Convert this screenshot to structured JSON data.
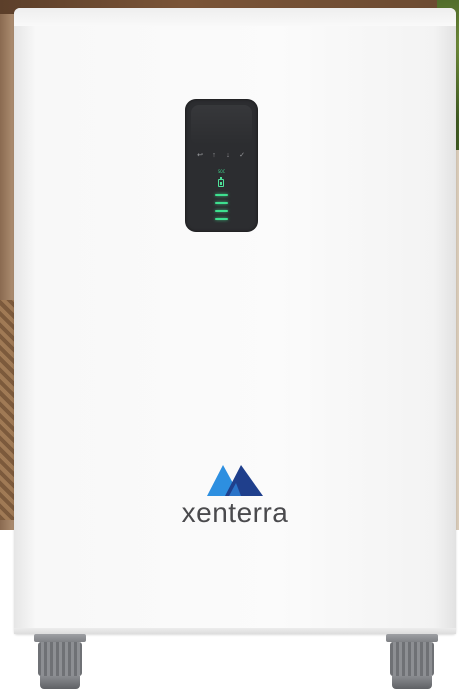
{
  "brand": {
    "name": "xenterra",
    "colors": {
      "wordmark": "#4a4a4d",
      "mark_left": "#2d8fe0",
      "mark_right": "#1f3f8c",
      "indicator_green": "#3ee08f",
      "panel": "#2c2d30",
      "cabinet": "#f7f7f7"
    },
    "logo_icon": "mountain-peaks-icon"
  },
  "panel": {
    "soc_label": "SOC",
    "buttons": [
      {
        "icon": "back-icon",
        "glyph": "↩"
      },
      {
        "icon": "up-icon",
        "glyph": "↑"
      },
      {
        "icon": "down-icon",
        "glyph": "↓"
      },
      {
        "icon": "confirm-icon",
        "glyph": "✓"
      }
    ],
    "battery_level_bars_lit": 4,
    "battery_level_bars_total": 4
  }
}
